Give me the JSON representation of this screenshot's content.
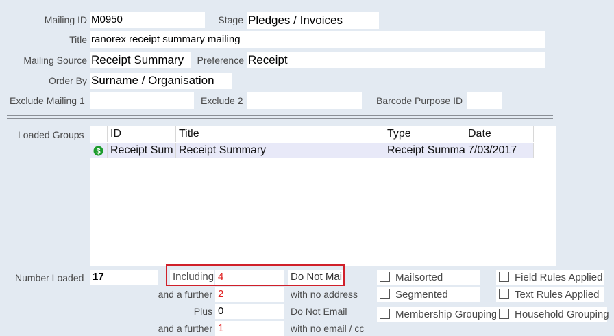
{
  "form": {
    "mailing_id_label": "Mailing ID",
    "mailing_id": "M0950",
    "stage_label": "Stage",
    "stage": "Pledges / Invoices",
    "title_label": "Title",
    "title": "ranorex receipt summary mailing",
    "mailing_source_label": "Mailing Source",
    "mailing_source": "Receipt Summary",
    "preference_label": "Preference",
    "preference": "Receipt",
    "order_by_label": "Order By",
    "order_by": "Surname / Organisation",
    "exclude1_label": "Exclude Mailing 1",
    "exclude1": "",
    "exclude2_label": "Exclude 2",
    "exclude2": "",
    "barcode_label": "Barcode Purpose ID",
    "barcode": ""
  },
  "groups": {
    "label": "Loaded Groups",
    "columns": [
      "ID",
      "Title",
      "Type",
      "Date"
    ],
    "rows": [
      {
        "icon": "green-dollar-icon",
        "id": "Receipt Sum",
        "title": "Receipt Summary",
        "type": "Receipt Summa",
        "date": "7/03/2017"
      }
    ]
  },
  "counts": {
    "number_loaded_label": "Number Loaded",
    "number_loaded": "17",
    "including_label": "Including",
    "including": "4",
    "do_not_mail": "Do Not Mail",
    "further1_label": "and a further",
    "further1": "2",
    "no_address": "with no address",
    "plus_label": "Plus",
    "plus": "0",
    "do_not_email": "Do Not Email",
    "further2_label": "and a further",
    "further2": "1",
    "no_email": "with no email / cc"
  },
  "options": {
    "mailsorted": "Mailsorted",
    "segmented": "Segmented",
    "membership_grouping": "Membership Grouping",
    "field_rules": "Field Rules Applied",
    "text_rules": "Text Rules Applied",
    "household_grouping": "Household Grouping"
  },
  "colors": {
    "background": "#e3eaf2",
    "highlight_border": "#d0202a",
    "red_values": "#e02020",
    "selected_row": "#e8e9f8"
  }
}
